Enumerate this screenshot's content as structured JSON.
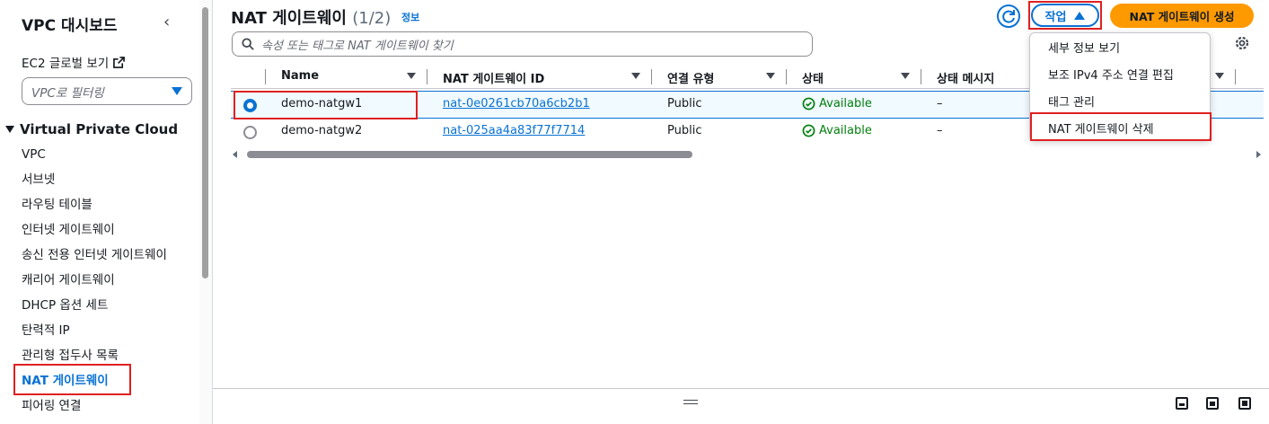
{
  "sidebar": {
    "title": "VPC 대시보드",
    "ec2_link": "EC2 글로벌 보기",
    "filter_placeholder": "VPC로 필터링",
    "section": "Virtual Private Cloud",
    "items": [
      {
        "label": "VPC"
      },
      {
        "label": "서브넷"
      },
      {
        "label": "라우팅 테이블"
      },
      {
        "label": "인터넷 게이트웨이"
      },
      {
        "label": "송신 전용 인터넷 게이트웨이"
      },
      {
        "label": "캐리어 게이트웨이"
      },
      {
        "label": "DHCP 옵션 세트"
      },
      {
        "label": "탄력적 IP"
      },
      {
        "label": "관리형 접두사 목록"
      },
      {
        "label": "NAT 게이트웨이"
      },
      {
        "label": "피어링 연결"
      }
    ]
  },
  "header": {
    "title": "NAT 게이트웨이",
    "count": "(1/2)",
    "info": "정보",
    "actions_label": "작업",
    "create_label": "NAT 게이트웨이 생성",
    "search_placeholder": "속성 또는 태그로 NAT 게이트웨이 찾기"
  },
  "table": {
    "columns": [
      "Name",
      "NAT 게이트웨이 ID",
      "연결 유형",
      "상태",
      "상태 메시지"
    ],
    "rows": [
      {
        "name": "demo-natgw1",
        "id": "nat-0e0261cb70a6cb2b1",
        "type": "Public",
        "state": "Available",
        "message": "–",
        "selected": true
      },
      {
        "name": "demo-natgw2",
        "id": "nat-025aa4a83f77f7714",
        "type": "Public",
        "state": "Available",
        "message": "–",
        "selected": false
      }
    ]
  },
  "actions_menu": {
    "items": [
      "세부 정보 보기",
      "보조 IPv4 주소 연결 편집",
      "태그 관리",
      "NAT 게이트웨이 삭제"
    ]
  },
  "colors": {
    "accent": "#0972d3",
    "primary_button": "#ff9900",
    "success": "#037f0c",
    "highlight": "#e02020"
  }
}
